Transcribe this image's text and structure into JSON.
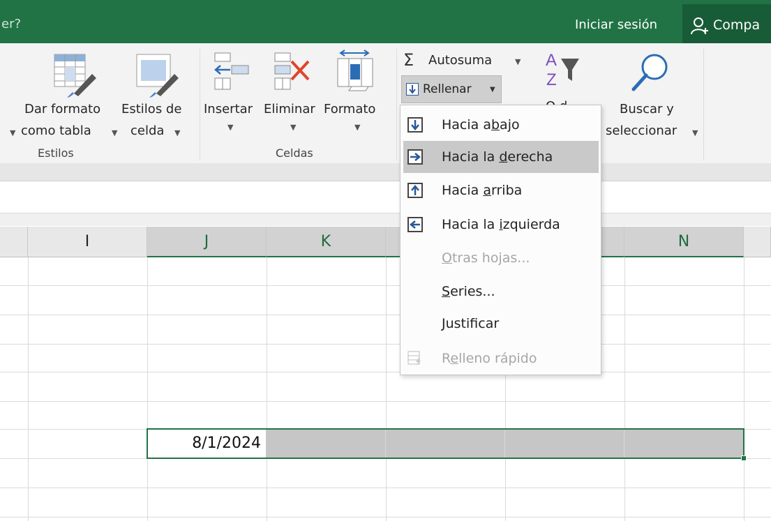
{
  "titlebar": {
    "search_hint": "er?",
    "signin_label": "Iniciar sesión",
    "share_label": "Compa"
  },
  "ribbon": {
    "estilos_group": "Estilos",
    "celdas_group": "Celdas",
    "dar_formato_line1": "Dar formato",
    "dar_formato_line2": "como tabla",
    "estilos_celda_line1": "Estilos de",
    "estilos_celda_line2": "celda",
    "insertar_label": "Insertar",
    "eliminar_label": "Eliminar",
    "formato_label": "Formato",
    "autosuma_label": "Autosuma",
    "autosuma_symbol": "Σ",
    "rellenar_label": "Rellenar",
    "ordenar_partial": "O d",
    "buscar_line1": "Buscar y",
    "buscar_line2": "seleccionar"
  },
  "menu": {
    "items": [
      {
        "pre": "Hacia a",
        "u": "b",
        "post": "ajo",
        "icon": "arrow-down-icon",
        "enabled": true
      },
      {
        "pre": "Hacia la ",
        "u": "d",
        "post": "erecha",
        "icon": "arrow-right-icon",
        "enabled": true,
        "highlighted": true
      },
      {
        "pre": "Hacia ",
        "u": "a",
        "post": "rriba",
        "icon": "arrow-up-icon",
        "enabled": true
      },
      {
        "pre": "Hacia la ",
        "u": "i",
        "post": "zquierda",
        "icon": "arrow-left-icon",
        "enabled": true
      },
      {
        "pre": "",
        "u": "O",
        "post": "tras hojas...",
        "enabled": false
      },
      {
        "pre": "",
        "u": "S",
        "post": "eries...",
        "enabled": true
      },
      {
        "pre": "",
        "u": "J",
        "post": "ustificar",
        "enabled": true
      },
      {
        "pre": "R",
        "u": "e",
        "post": "lleno rápido",
        "icon": "flash-fill-icon",
        "enabled": false
      }
    ]
  },
  "grid": {
    "columns": [
      "I",
      "J",
      "K",
      "",
      "",
      "N"
    ],
    "cell_value": "8/1/2024"
  },
  "colors": {
    "excel_green": "#217346",
    "share_green": "#185c37",
    "highlight": "#c9c9c9"
  }
}
